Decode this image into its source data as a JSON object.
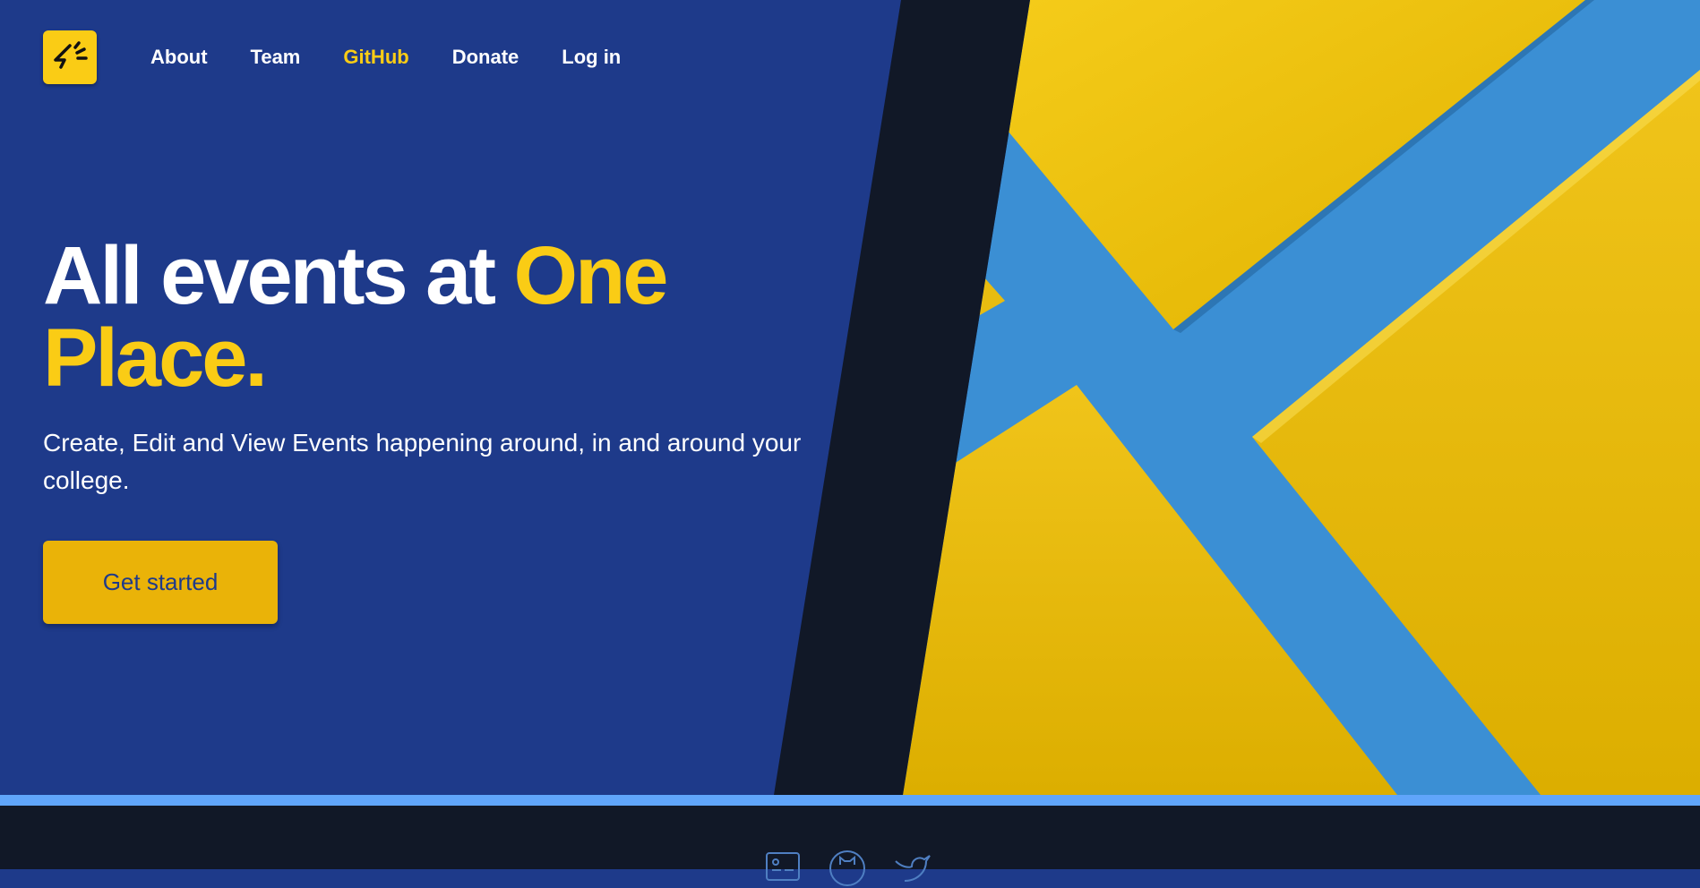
{
  "nav": {
    "logo_icon": "megaphone-icon",
    "links": [
      {
        "label": "About",
        "active": false
      },
      {
        "label": "Team",
        "active": false
      },
      {
        "label": "GitHub",
        "active": true
      },
      {
        "label": "Donate",
        "active": false
      },
      {
        "label": "Log in",
        "active": false
      }
    ]
  },
  "hero": {
    "headline_part1": "All events at ",
    "headline_highlight": "One Place.",
    "subtitle": "Create, Edit and View Events happening around, in and around your college.",
    "cta_label": "Get started"
  },
  "footer": {
    "icons": [
      "id-card-icon",
      "github-icon",
      "twitter-icon"
    ]
  },
  "colors": {
    "primary_bg": "#1e3a8a",
    "accent": "#facc15",
    "dark": "#111827",
    "strip": "#60a5fa",
    "art_blue": "#3b8fd4"
  }
}
